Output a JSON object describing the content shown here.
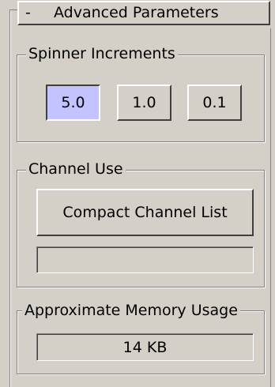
{
  "rollout": {
    "toggle": "-",
    "title": "Advanced Parameters"
  },
  "spinner_increments": {
    "label": "Spinner Increments",
    "buttons": [
      "5.0",
      "1.0",
      "0.1"
    ],
    "selected": "5.0"
  },
  "channel_use": {
    "label": "Channel Use",
    "compact_button": "Compact Channel List",
    "status_text": ""
  },
  "memory": {
    "label": "Approximate Memory Usage",
    "value": "14 KB"
  },
  "colors": {
    "panel_bg": "#d4d0c8",
    "selected_button_bg": "#c3c3ff"
  }
}
